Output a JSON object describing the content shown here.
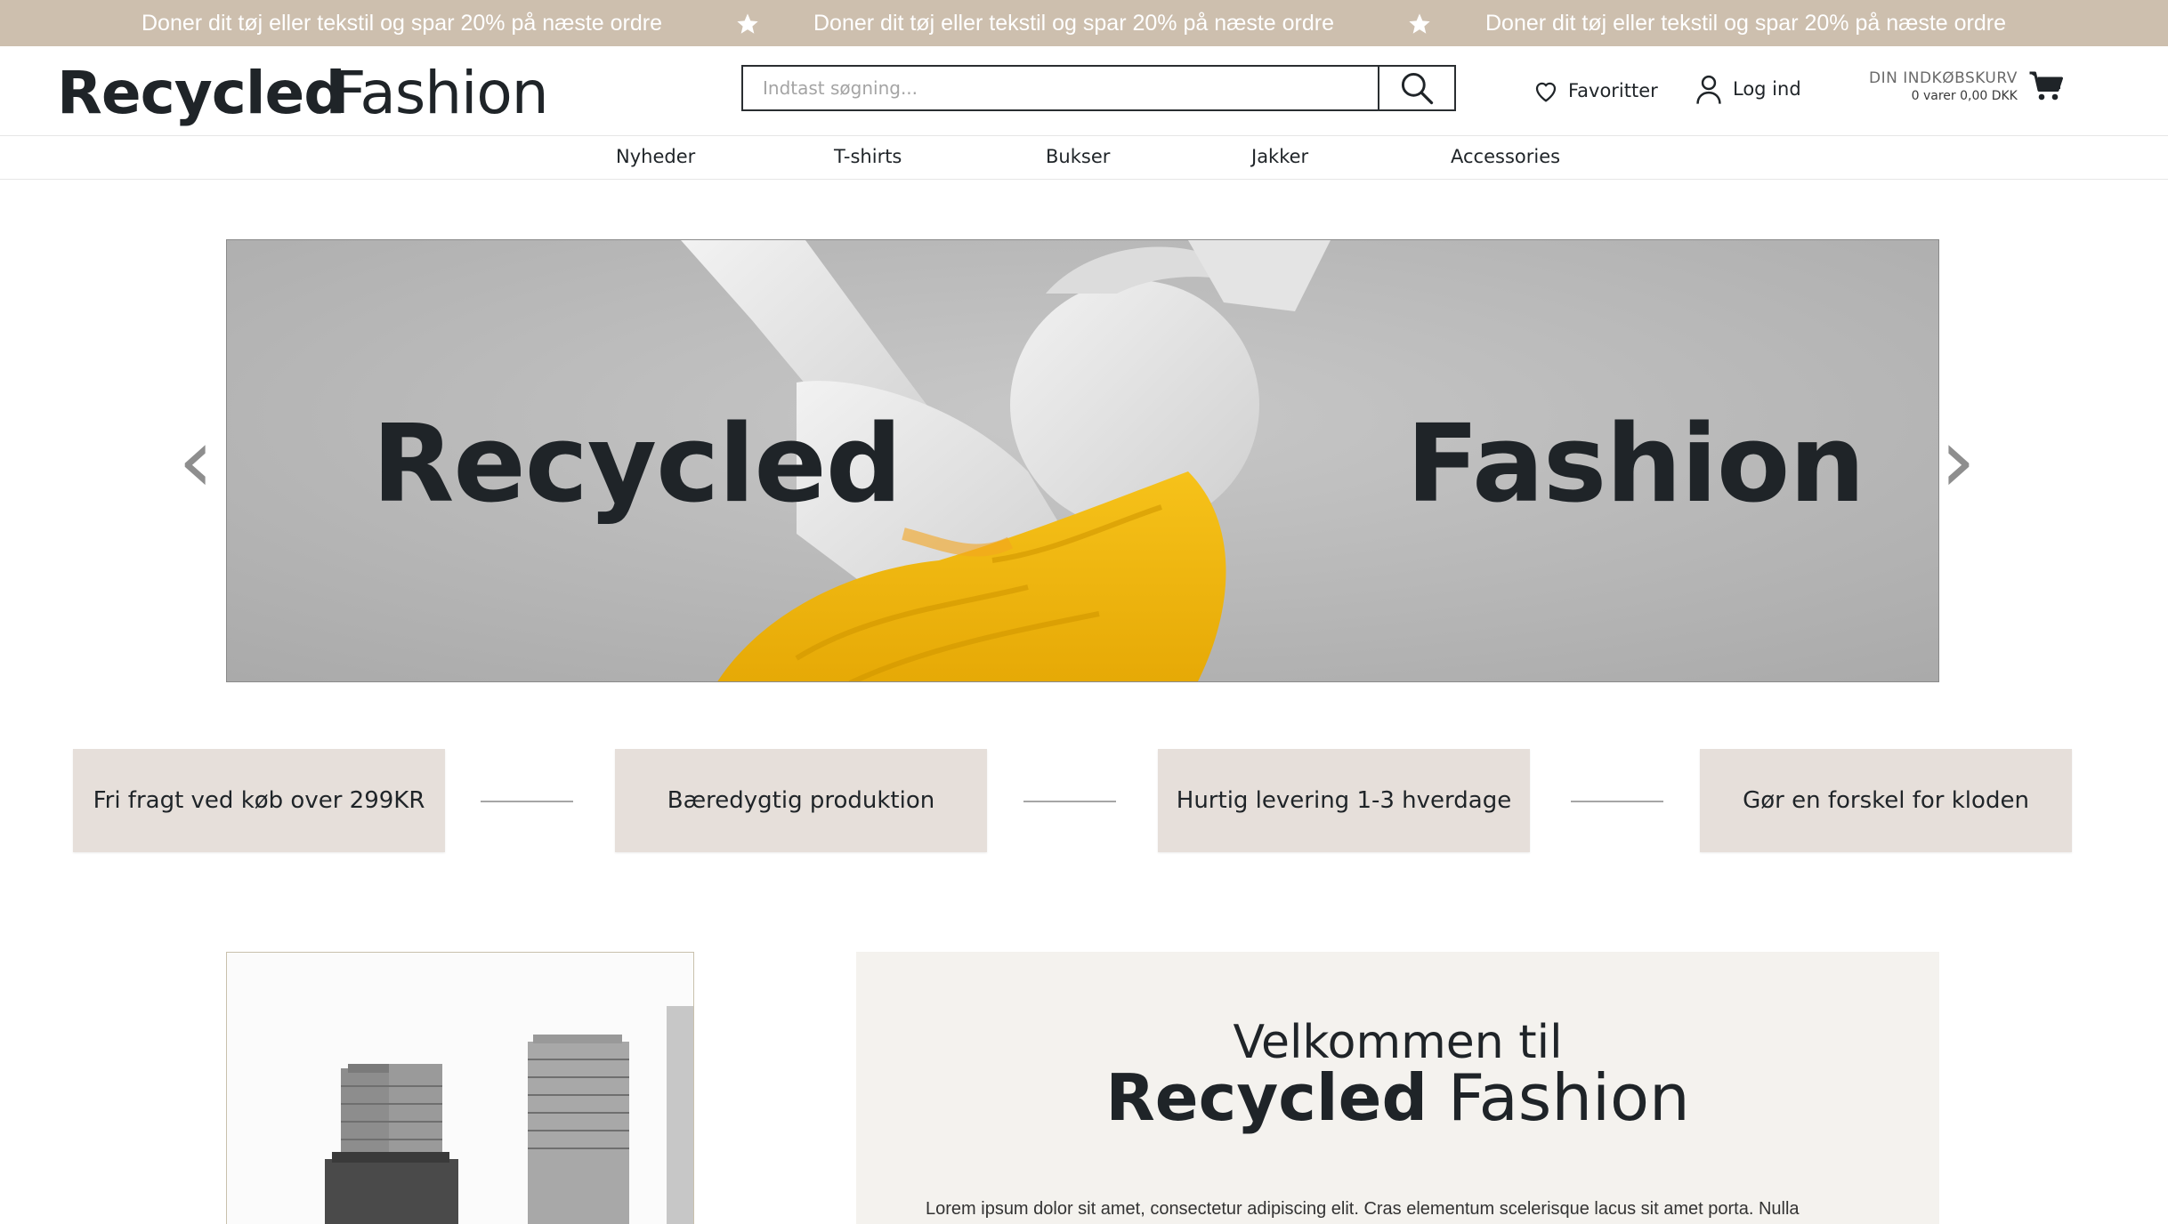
{
  "promo": {
    "message": "Doner dit tøj eller tekstil og spar 20% på næste ordre",
    "star_icon": "star-icon",
    "color": "#cdbfae"
  },
  "header": {
    "logo_part1": "Recycled",
    "logo_part2": "Fashion",
    "search_placeholder": "Indtast søgning...",
    "favorites_label": "Favoritter",
    "login_label": "Log ind",
    "cart_title": "DIN INDKØBSKURV",
    "cart_summary": "0 varer 0,00 DKK"
  },
  "nav": {
    "items": [
      "Nyheder",
      "T-shirts",
      "Bukser",
      "Jakker",
      "Accessories"
    ]
  },
  "hero": {
    "word1": "Recycled",
    "word2": "Fashion",
    "prev": "‹",
    "next": "›"
  },
  "features": [
    "Fri fragt ved køb over 299KR",
    "Bæredygtig produktion",
    "Hurtig levering 1-3 hverdage",
    "Gør en forskel for kloden"
  ],
  "welcome": {
    "line1": "Velkommen til",
    "brand1": "Recycled",
    "brand2": "Fashion",
    "lorem": "Lorem ipsum dolor sit amet, consectetur adipiscing elit. Cras elementum scelerisque lacus sit amet porta. Nulla"
  }
}
